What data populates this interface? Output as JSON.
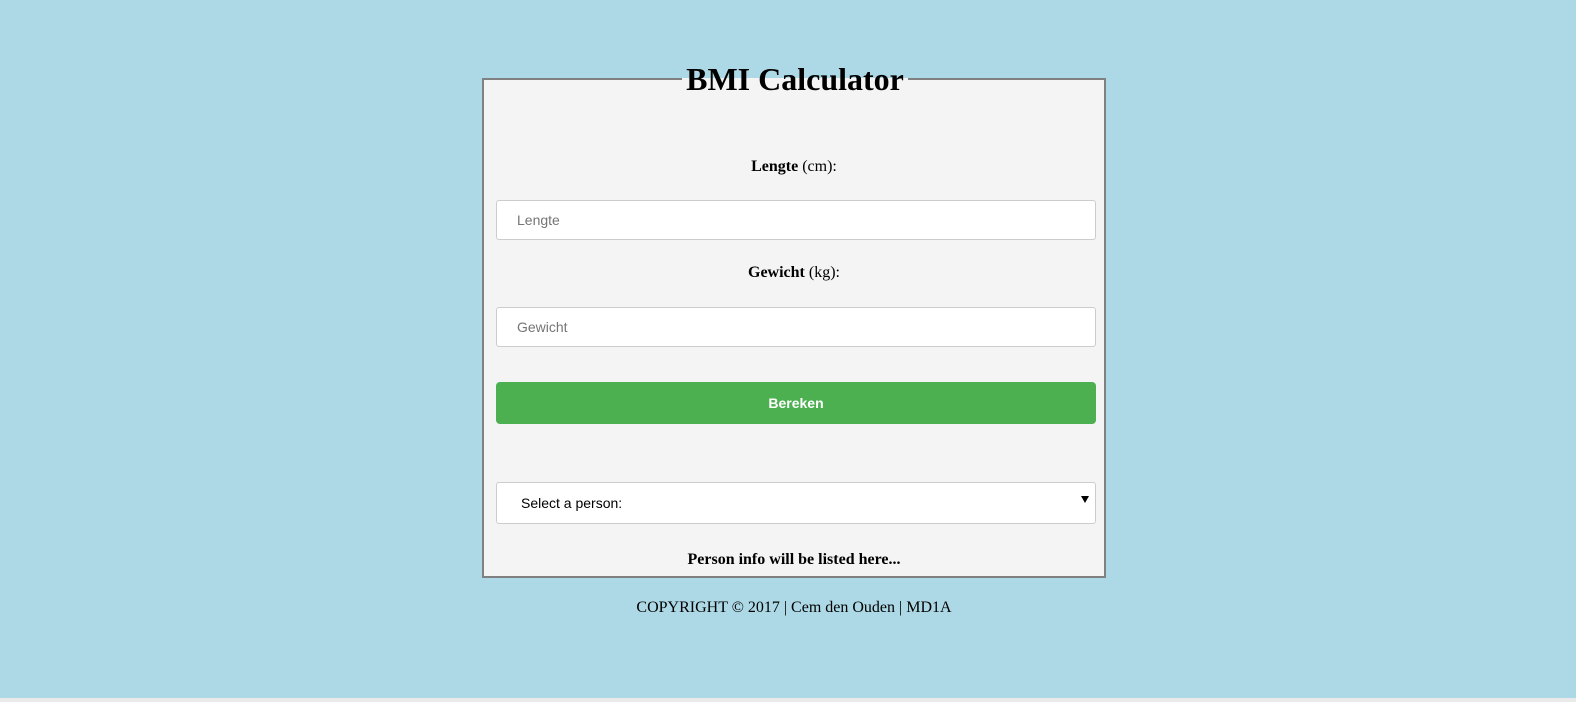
{
  "page": {
    "background_color": "#add8e6",
    "card_background": "#f4f4f4",
    "accent_color": "#4caf50"
  },
  "header": {
    "title": "BMI Calculator"
  },
  "form": {
    "length": {
      "label_bold": "Lengte",
      "label_unit": " (cm):",
      "placeholder": "Lengte",
      "value": ""
    },
    "weight": {
      "label_bold": "Gewicht",
      "label_unit": " (kg):",
      "placeholder": "Gewicht",
      "value": ""
    },
    "submit_label": "Bereken"
  },
  "person_select": {
    "selected_label": "Select a person:",
    "icon": "chevron-down-icon"
  },
  "person_info": {
    "text": "Person info will be listed here..."
  },
  "footer": {
    "copyright": "COPYRIGHT © 2017 | Cem den Ouden | MD1A"
  }
}
